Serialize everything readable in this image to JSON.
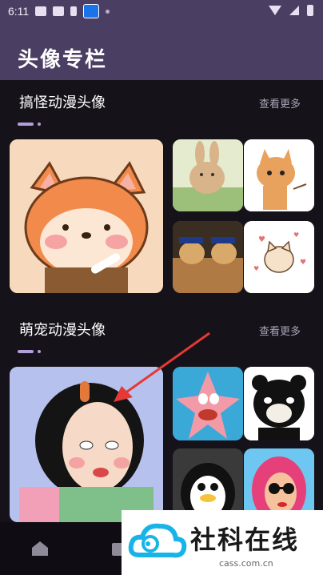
{
  "status_bar": {
    "time": "6:11"
  },
  "header": {
    "title": "头像专栏"
  },
  "sections": [
    {
      "title": "搞怪动漫头像",
      "more": "查看更多"
    },
    {
      "title": "萌宠动漫头像",
      "more": "查看更多"
    }
  ],
  "watermark": {
    "brand": "社科在线",
    "url": "cass.com.cn"
  },
  "colors": {
    "header_bg": "#4b3e63",
    "page_bg": "#15121a",
    "accent": "#b39ddb",
    "arrow": "#e53935"
  }
}
